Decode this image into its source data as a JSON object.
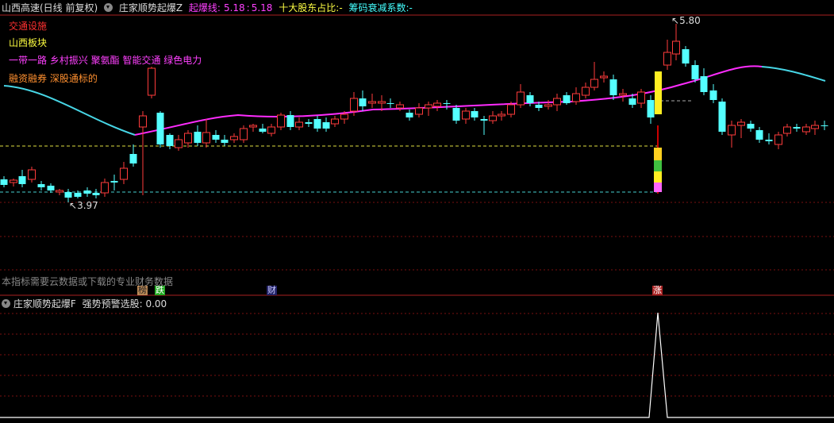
{
  "header": {
    "stock_title": "山西高速(日线 前复权)",
    "indicator_name": "庄家顺势起爆Z",
    "line_label": "起爆线:",
    "line_value_1": "5.18",
    "line_sep": ":",
    "line_value_2": "5.18",
    "holders_label": "十大股东占比:",
    "holders_value": "-",
    "decay_label": "筹码衰减系数:",
    "decay_value": "-"
  },
  "info_lines": {
    "industry": "交通设施",
    "region": "山西板块",
    "concepts": "一带一路 乡村振兴 聚氨酯 智能交通 绿色电力",
    "margin": "融资融券 深股通标的"
  },
  "price_labels": {
    "high": "5.80",
    "low": "3.97"
  },
  "notice": "本指标需要云数据或下载的专业财务数据",
  "markers": {
    "bang": "榜",
    "die": "跌",
    "cai": "财",
    "zhang": "涨"
  },
  "sub_panel": {
    "indicator_name": "庄家顺势起爆F",
    "signal_label": "强势预警选股:",
    "signal_value": "0.00"
  },
  "colors": {
    "up": "#ff3b3b",
    "down": "#54ffff",
    "ma_cyan": "#47d6e6",
    "ma_magenta": "#ff2cff",
    "yellow_dash": "#e0e040",
    "cyan_dash": "#46d0d0",
    "grid": "#7a1010"
  }
}
